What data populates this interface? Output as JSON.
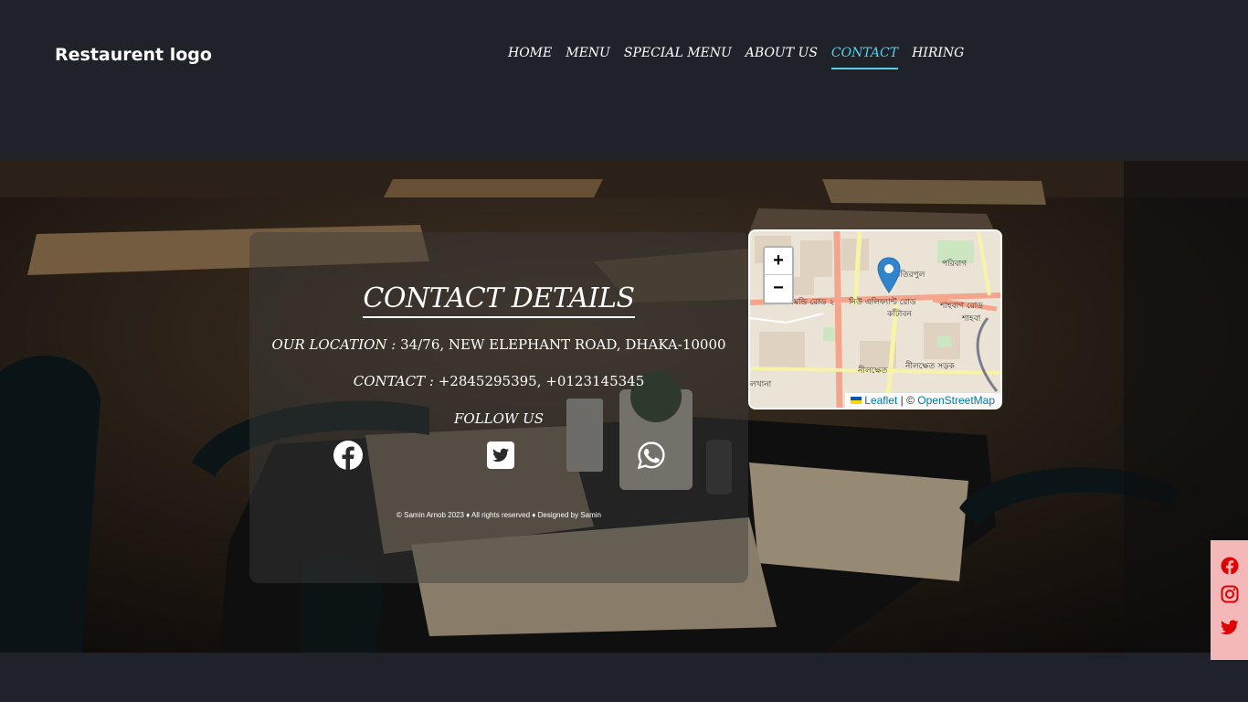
{
  "header": {
    "logo": "Restaurent logo",
    "nav": [
      "HOME",
      "MENU",
      "SPECIAL MENU",
      "ABOUT US",
      "CONTACT",
      "HIRING"
    ],
    "active": "CONTACT",
    "accent": "#5ccfe6"
  },
  "contact": {
    "title": "CONTACT DETAILS",
    "location_label": "OUR LOCATION :",
    "location_value": " 34/76, NEW ELEPHANT ROAD, DHAKA-10000",
    "contact_label": "CONTACT :",
    "contact_value": " +2845295395, +0123145345",
    "follow_label": "FOLLOW US",
    "social_icons": [
      "facebook-icon",
      "twitter-icon",
      "whatsapp-icon"
    ],
    "footer": "© Samin Arnob 2023 ♦ All rights reserved ♦ Designed by Samin"
  },
  "map": {
    "zoom_in": "+",
    "zoom_out": "−",
    "attribution_leaflet": "Leaflet",
    "attribution_sep": " | © ",
    "attribution_osm": "OpenStreetMap",
    "labels": [
      "পরিবাগ",
      "ভিতিরপুল",
      "ধানমন্ডি রোড ২",
      "নিউ এলিফ্যান্ট রোড",
      "শাহবাগ রোড",
      "কাঁটাবন",
      "শাহবা",
      "নীলক্ষেত",
      "নীলক্ষেত সড়ক",
      "লখানা"
    ]
  },
  "floating_social": {
    "icons": [
      "facebook-icon",
      "instagram-icon",
      "twitter-icon"
    ],
    "color": "#e00000",
    "background": "#f5b8b8"
  }
}
